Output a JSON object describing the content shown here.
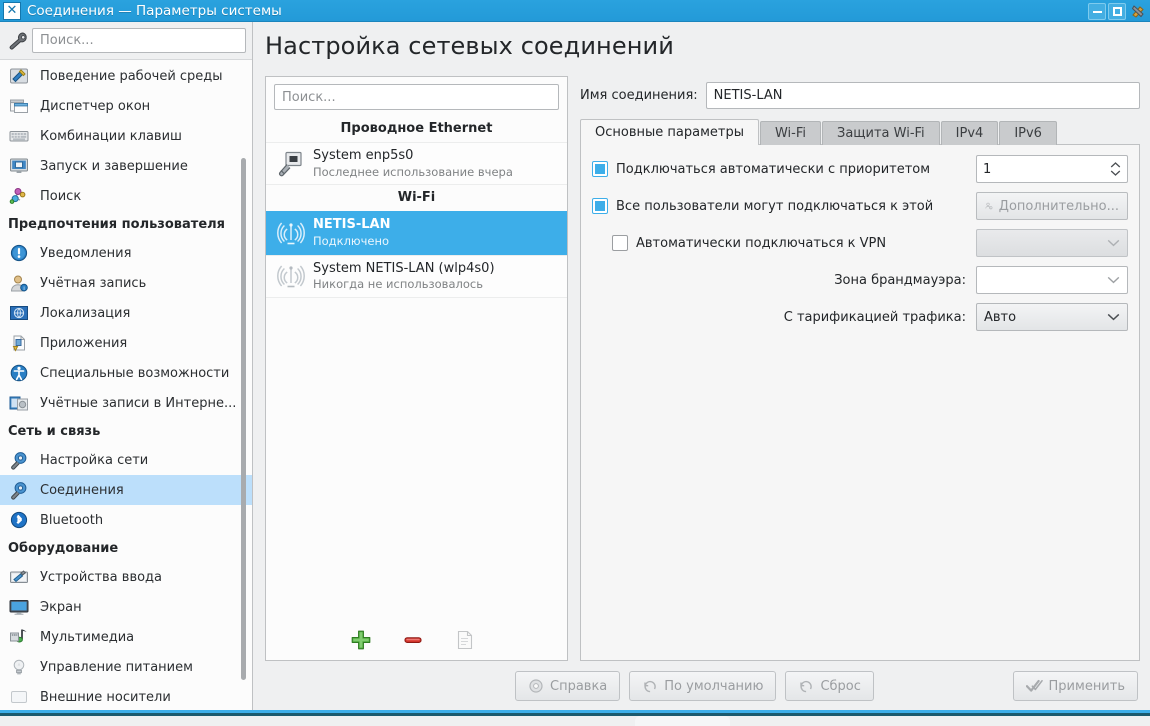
{
  "window": {
    "title": "Соединения — Параметры системы",
    "app_icon": "close-x-icon",
    "buttons": {
      "minimize": "minimize-icon",
      "maximize": "maximize-icon",
      "close": "close-icon"
    }
  },
  "sidebar": {
    "search": {
      "placeholder": "Поиск...",
      "value": ""
    },
    "wrench_icon": "wrench-icon",
    "entries": [
      {
        "kind": "item",
        "label": "Поведение рабочей среды",
        "icon": "desktop-behavior-icon",
        "selected": false
      },
      {
        "kind": "item",
        "label": "Диспетчер окон",
        "icon": "window-manager-icon",
        "selected": false
      },
      {
        "kind": "item",
        "label": "Комбинации клавиш",
        "icon": "keyboard-icon",
        "selected": false
      },
      {
        "kind": "item",
        "label": "Запуск и завершение",
        "icon": "startup-shutdown-icon",
        "selected": false
      },
      {
        "kind": "item",
        "label": "Поиск",
        "icon": "search-molecule-icon",
        "selected": false
      },
      {
        "kind": "section",
        "label": "Предпочтения пользователя"
      },
      {
        "kind": "item",
        "label": "Уведомления",
        "icon": "notification-icon",
        "selected": false
      },
      {
        "kind": "item",
        "label": "Учётная запись",
        "icon": "user-account-icon",
        "selected": false
      },
      {
        "kind": "item",
        "label": "Локализация",
        "icon": "globe-flag-icon",
        "selected": false
      },
      {
        "kind": "item",
        "label": "Приложения",
        "icon": "applications-icon",
        "selected": false
      },
      {
        "kind": "item",
        "label": "Специальные возможности",
        "icon": "accessibility-icon",
        "selected": false
      },
      {
        "kind": "item",
        "label": "Учётные записи в Интерне...",
        "icon": "online-accounts-icon",
        "selected": false
      },
      {
        "kind": "section",
        "label": "Сеть и связь"
      },
      {
        "kind": "item",
        "label": "Настройка сети",
        "icon": "network-settings-icon",
        "selected": false
      },
      {
        "kind": "item",
        "label": "Соединения",
        "icon": "connections-icon",
        "selected": true
      },
      {
        "kind": "item",
        "label": "Bluetooth",
        "icon": "bluetooth-icon",
        "selected": false
      },
      {
        "kind": "section",
        "label": "Оборудование"
      },
      {
        "kind": "item",
        "label": "Устройства ввода",
        "icon": "input-devices-icon",
        "selected": false
      },
      {
        "kind": "item",
        "label": "Экран",
        "icon": "display-icon",
        "selected": false
      },
      {
        "kind": "item",
        "label": "Мультимедиа",
        "icon": "multimedia-icon",
        "selected": false
      },
      {
        "kind": "item",
        "label": "Управление питанием",
        "icon": "power-icon",
        "selected": false
      },
      {
        "kind": "item",
        "label": "Внешние носители",
        "icon": "removable-media-icon",
        "selected": false
      }
    ]
  },
  "page": {
    "title": "Настройка сетевых соединений"
  },
  "connection_list": {
    "search": {
      "placeholder": "Поиск...",
      "value": ""
    },
    "groups": [
      {
        "header": "Проводное Ethernet",
        "items": [
          {
            "name": "System enp5s0",
            "status": "Последнее использование вчера",
            "icon": "ethernet-plug-icon",
            "selected": false
          }
        ]
      },
      {
        "header": "Wi-Fi",
        "items": [
          {
            "name": "NETIS-LAN",
            "status": "Подключено",
            "icon": "wifi-antenna-icon",
            "selected": true
          },
          {
            "name": "System NETIS-LAN (wlp4s0)",
            "status": "Никогда не использовалось",
            "icon": "wifi-antenna-icon",
            "selected": false
          }
        ]
      }
    ],
    "toolbar": [
      {
        "name": "add-connection-button",
        "icon": "plus-icon",
        "enabled": true
      },
      {
        "name": "remove-connection-button",
        "icon": "minus-icon",
        "enabled": true
      },
      {
        "name": "duplicate-connection-button",
        "icon": "copy-page-icon",
        "enabled": false
      }
    ]
  },
  "settings": {
    "name_label": "Имя соединения:",
    "name_value": "NETIS-LAN",
    "tabs": [
      {
        "label": "Основные параметры",
        "active": true
      },
      {
        "label": "Wi-Fi",
        "active": false
      },
      {
        "label": "Защита Wi-Fi",
        "active": false
      },
      {
        "label": "IPv4",
        "active": false
      },
      {
        "label": "IPv6",
        "active": false
      }
    ],
    "fields": {
      "autoconnect_label": "Подключаться автоматически с приоритетом",
      "autoconnect_checked": true,
      "priority_value": "1",
      "all_users_label": "Все пользователи могут подключаться к этой",
      "all_users_checked": true,
      "advanced_button": "Дополнительно...",
      "advanced_icon": "user-key-icon",
      "vpn_label": "Автоматически подключаться к VPN",
      "vpn_checked": false,
      "vpn_value": "",
      "firewall_label": "Зона брандмауэра:",
      "firewall_value": "",
      "metered_label": "С тарификацией трафика:",
      "metered_value": "Авто"
    }
  },
  "footer": {
    "help": {
      "label": "Справка",
      "icon": "help-icon"
    },
    "defaults": {
      "label": "По умолчанию",
      "icon": "revert-icon"
    },
    "reset": {
      "label": "Сброс",
      "icon": "undo-icon"
    },
    "apply": {
      "label": "Применить",
      "icon": "check-icon"
    }
  },
  "colors": {
    "titlebar": "#2aa2de",
    "selection": "#3daee9",
    "sidebar_selection": "#bcdffb",
    "panel_bg": "#eff0f1",
    "content_bg": "#f6f6f6"
  }
}
